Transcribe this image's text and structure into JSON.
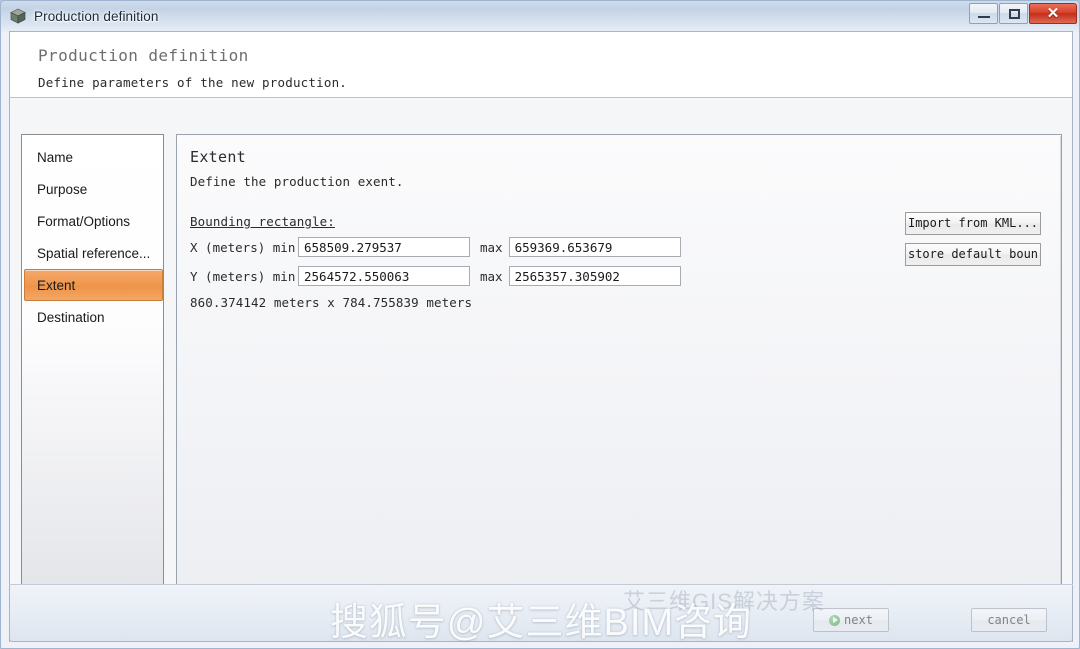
{
  "window": {
    "title": "Production definition",
    "icon": "cube-icon",
    "buttons": {
      "minimize": "minimize-icon",
      "restore": "restore-icon",
      "close": "✕"
    }
  },
  "header": {
    "title": "Production definition",
    "subtitle": "Define parameters of the new production."
  },
  "sidebar": {
    "items": [
      {
        "label": "Name",
        "selected": false
      },
      {
        "label": "Purpose",
        "selected": false
      },
      {
        "label": "Format/Options",
        "selected": false
      },
      {
        "label": "Spatial reference...",
        "selected": false
      },
      {
        "label": "Extent",
        "selected": true
      },
      {
        "label": "Destination",
        "selected": false
      }
    ]
  },
  "content": {
    "title": "Extent",
    "subtitle": "Define the production exent.",
    "bounding_label": "Bounding rectangle:",
    "rows": [
      {
        "axis_label": "X (meters) min",
        "min_value": "658509.279537",
        "max_label": "max",
        "max_value": "659369.653679"
      },
      {
        "axis_label": "Y (meters) min",
        "min_value": "2564572.550063",
        "max_label": "max",
        "max_value": "2565357.305902"
      }
    ],
    "dimension_text": "860.374142 meters x 784.755839 meters",
    "buttons": {
      "import_kml": "Import from KML...",
      "store_default": "store default boun"
    }
  },
  "footer": {
    "next_label": "next",
    "cancel_label": "cancel"
  },
  "watermark": {
    "text": "搜狐号@艾三维BIM咨询",
    "ghost": "艾三维GIS解决方案"
  },
  "colors": {
    "accent_orange": "#ed9448",
    "title_blue": "#1e2a38",
    "close_red": "#d9402a",
    "panel_bg": "#f5f6f8"
  }
}
